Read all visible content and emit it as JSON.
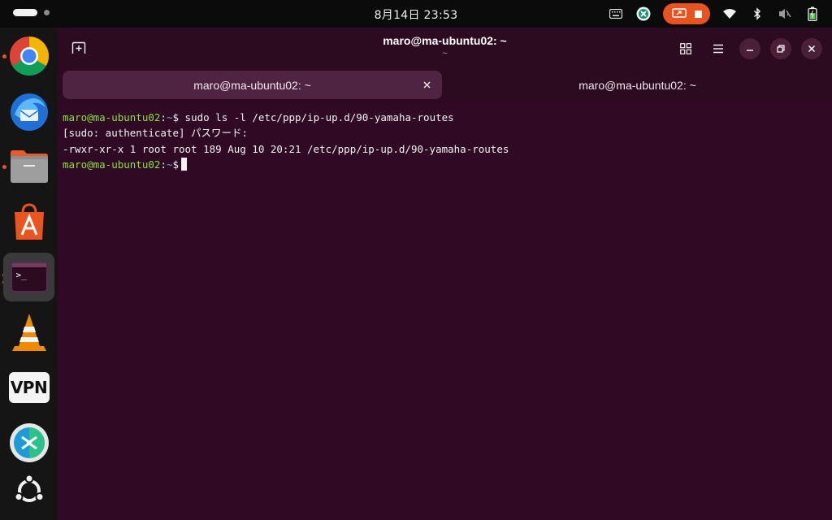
{
  "topbar": {
    "clock": "8月14日  23:53",
    "icons": [
      "keyboard-icon",
      "remote-desktop-icon",
      "screen-record-icon",
      "wifi-icon",
      "bluetooth-icon",
      "volume-muted-icon",
      "battery-icon"
    ],
    "record_color": "#e8531f"
  },
  "dock": {
    "apps": [
      "chrome",
      "thunderbird",
      "files",
      "app-center",
      "terminal",
      "vlc",
      "vpn",
      "remote-desktop",
      "ubuntu-menu"
    ],
    "vpn_label": "VPN",
    "terminal_label": ">_"
  },
  "window": {
    "title": "maro@ma-ubuntu02: ~",
    "subtitle": "~",
    "tabs": [
      {
        "label": "maro@ma-ubuntu02: ~",
        "active": true
      },
      {
        "label": "maro@ma-ubuntu02: ~",
        "active": false
      }
    ],
    "tab_close": "×"
  },
  "terminal": {
    "prompt_user": "maro@ma-ubuntu02",
    "prompt_sep": ":",
    "prompt_dir": "~",
    "prompt_sym": "$",
    "line1_cmd": " sudo ls -l /etc/ppp/ip-up.d/90-yamaha-routes",
    "line2": "[sudo: authenticate] パスワード:",
    "line3": "-rwxr-xr-x 1 root root 189 Aug 10 20:21 /etc/ppp/ip-up.d/90-yamaha-routes",
    "colors": {
      "background": "#300a24",
      "user": "#8ae234",
      "dir": "#729fcf",
      "text": "#f2f2f2"
    }
  }
}
